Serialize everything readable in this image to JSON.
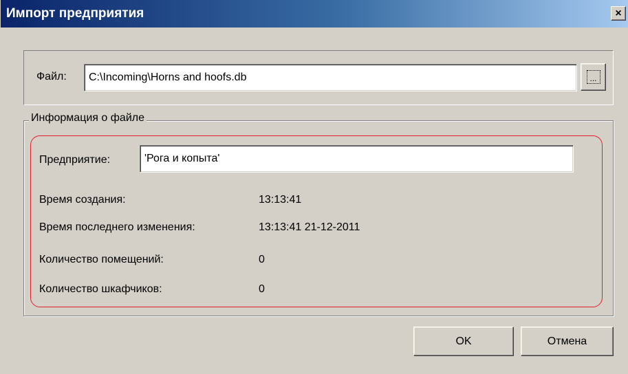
{
  "window": {
    "title": "Импорт предприятия",
    "close_glyph": "×"
  },
  "file": {
    "label": "Файл:",
    "value": "C:\\Incoming\\Horns and hoofs.db",
    "browse_glyph": "..."
  },
  "info": {
    "group_title": "Информация о файле",
    "enterprise_label": "Предприятие:",
    "enterprise_value": "'Рога и копыта'",
    "rows": [
      {
        "label": "Время создания:",
        "value": "13:13:41"
      },
      {
        "label": "Время последнего изменения:",
        "value": "13:13:41 21-12-2011"
      },
      {
        "label": "Количество помещений:",
        "value": "0"
      },
      {
        "label": "Количество шкафчиков:",
        "value": "0"
      }
    ]
  },
  "buttons": {
    "ok": "OK",
    "cancel": "Отмена"
  },
  "colors": {
    "titlebar_start": "#0a246a",
    "titlebar_end": "#a6caf0",
    "dialog_face": "#d4d0c8",
    "highlight_outline": "#e0202a"
  }
}
